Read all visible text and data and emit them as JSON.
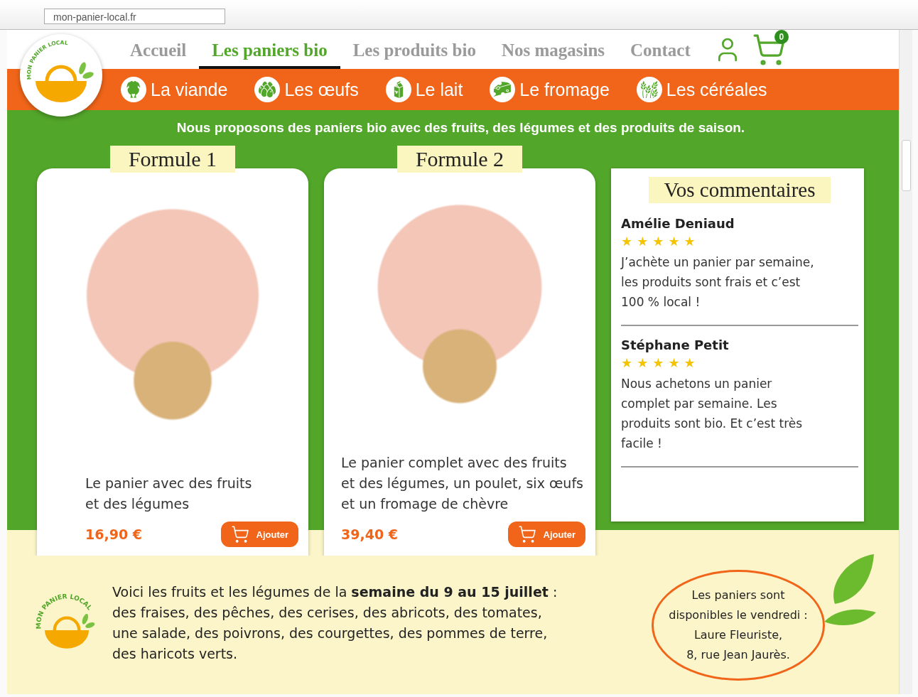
{
  "address_bar": {
    "url": "mon-panier-local.fr"
  },
  "logo": {
    "text": "MON PANIER LOCAL"
  },
  "nav": [
    {
      "label": "Accueil",
      "selected": false
    },
    {
      "label": "Les paniers bio",
      "selected": true
    },
    {
      "label": "Les produits bio",
      "selected": false
    },
    {
      "label": "Nos magasins",
      "selected": false
    },
    {
      "label": "Contact",
      "selected": false
    }
  ],
  "cart": {
    "count": "0"
  },
  "categories": [
    {
      "label": "La viande"
    },
    {
      "label": "Les œufs"
    },
    {
      "label": "Le lait"
    },
    {
      "label": "Le fromage"
    },
    {
      "label": "Les céréales"
    }
  ],
  "tagline": "Nous proposons des paniers bio avec des fruits, des légumes et des produits de saison.",
  "formulas": [
    {
      "title": "Formule 1",
      "description": [
        "Le panier avec des fruits",
        "et des légumes"
      ],
      "price": "16,90 €",
      "button": "Ajouter"
    },
    {
      "title": "Formule 2",
      "description": [
        "Le panier complet avec des fruits",
        "et des légumes, un poulet, six œufs",
        "et un fromage de chèvre"
      ],
      "price": "39,40 €",
      "button": "Ajouter"
    }
  ],
  "comments": {
    "title": "Vos commentaires",
    "items": [
      {
        "author": "Amélie Deniaud",
        "stars": 5,
        "text": [
          "J’achète un panier par semaine,",
          "les produits sont frais et c’est",
          "100 % local !"
        ]
      },
      {
        "author": "Stéphane Petit",
        "stars": 5,
        "text": [
          "Nous achetons un panier",
          "complet par semaine. Les",
          "produits sont bio. Et c’est très",
          "facile !"
        ]
      }
    ]
  },
  "week": {
    "logo_text": "MON PANIER LOCAL",
    "lines": [
      "Voici les fruits et les légumes de la **semaine du 9 au 15 juillet** :",
      "des fraises, des pêches, des cerises, des abricots, des tomates,",
      "une salade, des poivrons, des courgettes, des pommes de terre,",
      "des haricots verts."
    ]
  },
  "pickup": {
    "lines": [
      "Les paniers sont",
      "disponibles le vendredi :",
      "Laure Fleuriste,",
      "8, rue Jean Jaurès."
    ]
  }
}
